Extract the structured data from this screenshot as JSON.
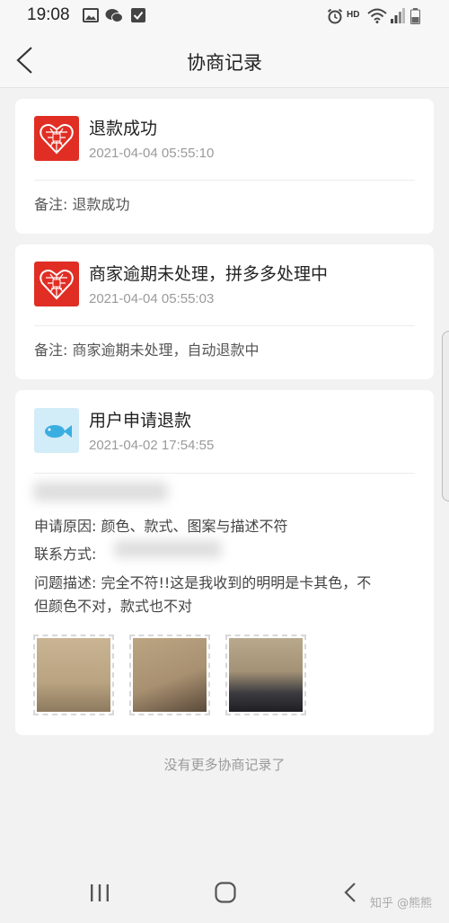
{
  "status_bar": {
    "time": "19:08",
    "network_label": "HD"
  },
  "nav": {
    "title": "协商记录"
  },
  "records": [
    {
      "title": "退款成功",
      "time": "2021-04-04 05:55:10",
      "note": "备注: 退款成功"
    },
    {
      "title": "商家逾期未处理，拼多多处理中",
      "time": "2021-04-04 05:55:03",
      "note": "备注: 商家逾期未处理，自动退款中"
    },
    {
      "title": "用户申请退款",
      "time": "2021-04-02 17:54:55",
      "reason": "申请原因: 颜色、款式、图案与描述不符",
      "contact_label": "联系方式:",
      "description_line1": "问题描述: 完全不符!!这是我收到的明明是卡其色，不",
      "description_line2": "但颜色不对，款式也不对"
    }
  ],
  "footer": {
    "no_more": "没有更多协商记录了"
  },
  "watermark": "知乎 @熊熊",
  "colors": {
    "pdd_red": "#e02e24",
    "user_logo_bg": "#d2ecf8",
    "page_bg": "#f2f2f2"
  }
}
